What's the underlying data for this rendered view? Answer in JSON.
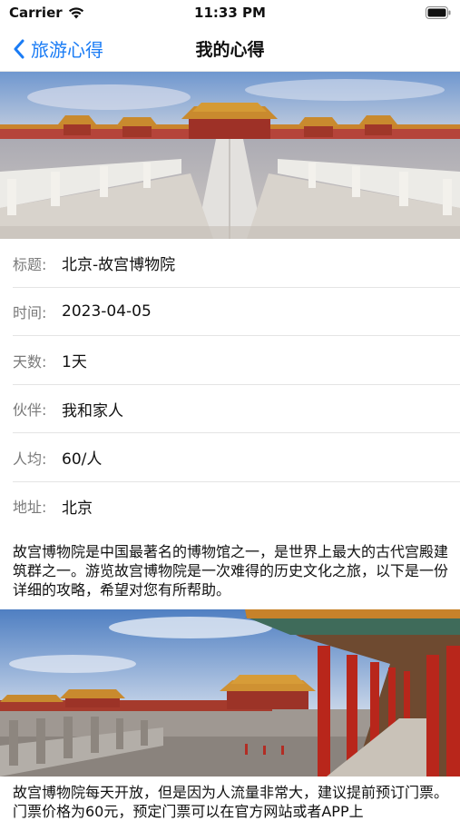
{
  "status_bar": {
    "carrier": "Carrier",
    "time": "11:33 PM"
  },
  "nav": {
    "back_label": "旅游心得",
    "title": "我的心得"
  },
  "info": [
    {
      "label": "标题:",
      "value": "北京-故宫博物院"
    },
    {
      "label": "时间:",
      "value": "2023-04-05"
    },
    {
      "label": "天数:",
      "value": "1天"
    },
    {
      "label": "伙伴:",
      "value": "我和家人"
    },
    {
      "label": "人均:",
      "value": "60/人"
    },
    {
      "label": "地址:",
      "value": "北京"
    }
  ],
  "paragraphs": [
    "故宫博物院是中国最著名的博物馆之一，是世界上最大的古代宫殿建筑群之一。游览故宫博物院是一次难得的历史文化之旅，以下是一份详细的攻略，希望对您有所帮助。",
    "故宫博物院每天开放，但是因为人流量非常大，建议提前预订门票。门票价格为60元，预定门票可以在官方网站或者APP上"
  ],
  "colors": {
    "accent": "#1a7cf5"
  }
}
